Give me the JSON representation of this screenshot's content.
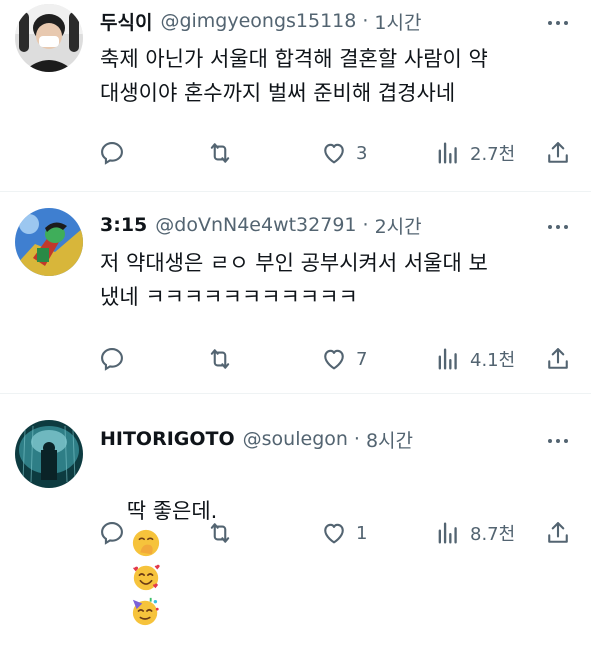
{
  "tweets": [
    {
      "name": "두식이",
      "handle": "@gimgyeongs15118",
      "dot": "·",
      "time": "1시간",
      "text": "축제 아닌가 서울대 합격해 결혼할 사람이 약\n대생이야 혼수까지 벌써 준비해 겹경사네",
      "likes": "3",
      "views": "2.7천"
    },
    {
      "name": "3:15",
      "handle": "@doVnN4e4wt32791",
      "dot": "·",
      "time": "2시간",
      "text": "저 약대생은 ㄹㅇ 부인 공부시켜서 서울대 보\n냈네 ㅋㅋㅋㅋㅋㅋㅋㅋㅋㅋㅋ",
      "likes": "7",
      "views": "4.1천"
    },
    {
      "name": "HITORIGOTO",
      "handle": "@soulegon",
      "dot": "·",
      "time": "8시간",
      "text": "딱 좋은데.",
      "emojis": [
        "hand-over-mouth-face",
        "smiling-face-with-hearts",
        "partying-face"
      ],
      "likes": "1",
      "views": "8.7천"
    }
  ],
  "icons": {
    "reply": "reply-icon",
    "retweet": "retweet-icon",
    "like": "heart-icon",
    "views": "views-icon",
    "share": "share-icon",
    "more": "more-icon"
  },
  "colors": {
    "text": "#0f1419",
    "secondary": "#536471",
    "divider": "#eff3f4"
  }
}
